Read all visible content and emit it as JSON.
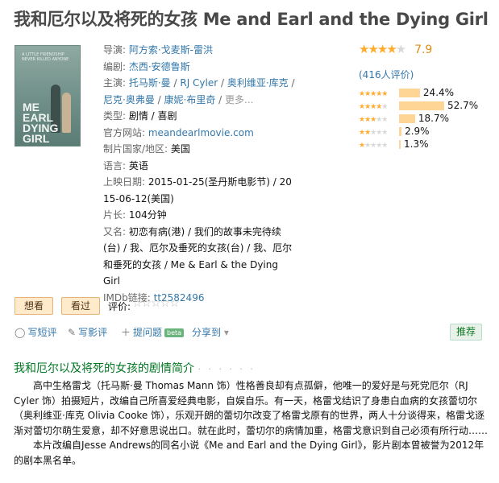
{
  "title": "我和厄尔以及将死的女孩 Me and Earl and the Dying Girl",
  "poster": {
    "tagline": "A LITTLE FRIENDSHIP NEVER KILLED ANYONE",
    "name_lines": [
      "ME",
      "EARL",
      "DYING",
      "GIRL"
    ]
  },
  "info": {
    "director_label": "导演: ",
    "director": "阿方索·戈麦斯-雷洪",
    "writer_label": "编剧: ",
    "writer": "杰西·安德鲁斯",
    "cast_label": "主演: ",
    "cast": [
      "托马斯·曼",
      "RJ Cyler",
      "奥利维亚·库克",
      "尼克·奥弗曼",
      "康妮·布里奇"
    ],
    "cast_more": "更多...",
    "genre_label": "类型: ",
    "genre": "剧情 / 喜剧",
    "site_label": "官方网站: ",
    "site": "meandearlmovie.com",
    "country_label": "制片国家/地区: ",
    "country": "美国",
    "language_label": "语言: ",
    "language": "英语",
    "release_label": "上映日期: ",
    "release": "2015-01-25(圣丹斯电影节) / 2015-06-12(美国)",
    "runtime_label": "片长: ",
    "runtime": "104分钟",
    "aka_label": "又名: ",
    "aka": "初恋有病(港) / 我们的故事未完待续(台) / 我、厄尔及垂死的女孩(台) / 我、厄尔和垂死的女孩 / Me & Earl & the Dying Girl",
    "imdb_label": "IMDb链接: ",
    "imdb": "tt2582496"
  },
  "rating": {
    "score": "7.9",
    "score_value": 7.9,
    "votes": "(416人评价)",
    "distribution": [
      {
        "stars": 5,
        "pct": "24.4%",
        "value": 24.4
      },
      {
        "stars": 4,
        "pct": "52.7%",
        "value": 52.7
      },
      {
        "stars": 3,
        "pct": "18.7%",
        "value": 18.7
      },
      {
        "stars": 2,
        "pct": "2.9%",
        "value": 2.9
      },
      {
        "stars": 1,
        "pct": "1.3%",
        "value": 1.3
      }
    ]
  },
  "buttons": {
    "want": "想看",
    "seen": "看过",
    "rate_label": "评价:"
  },
  "actions": {
    "write_review": "写短评",
    "write_longreview": "写影评",
    "ask": "提问题",
    "beta": "beta",
    "share": "分享到",
    "recommend": "推荐"
  },
  "summary": {
    "title": "我和厄尔以及将死的女孩的剧情简介",
    "dots": "· · · · · ·",
    "p1": "高中生格雷戈（托马斯·曼 Thomas Mann 饰）性格善良却有点孤僻，他唯一的爱好是与死党厄尔（RJ Cyler 饰）拍摄短片，改编自己所喜爱经典电影，自娱自乐。有一天，格雷戈结识了身患白血病的女孩蕾切尔（奥利维亚·库克 Olivia Cooke 饰），乐观开朗的蕾切尔改变了格雷戈原有的世界，两人十分谈得来，格雷戈逐渐对蕾切尔萌生爱意，却不好意思说出口。就在此时，蕾切尔的病情加重，格雷戈意识到自己必须有所行动……",
    "p2": "本片改编自Jesse Andrews的同名小说《Me and Earl and the Dying Girl》，影片剧本曾被誉为2012年的剧本黑名单。"
  }
}
